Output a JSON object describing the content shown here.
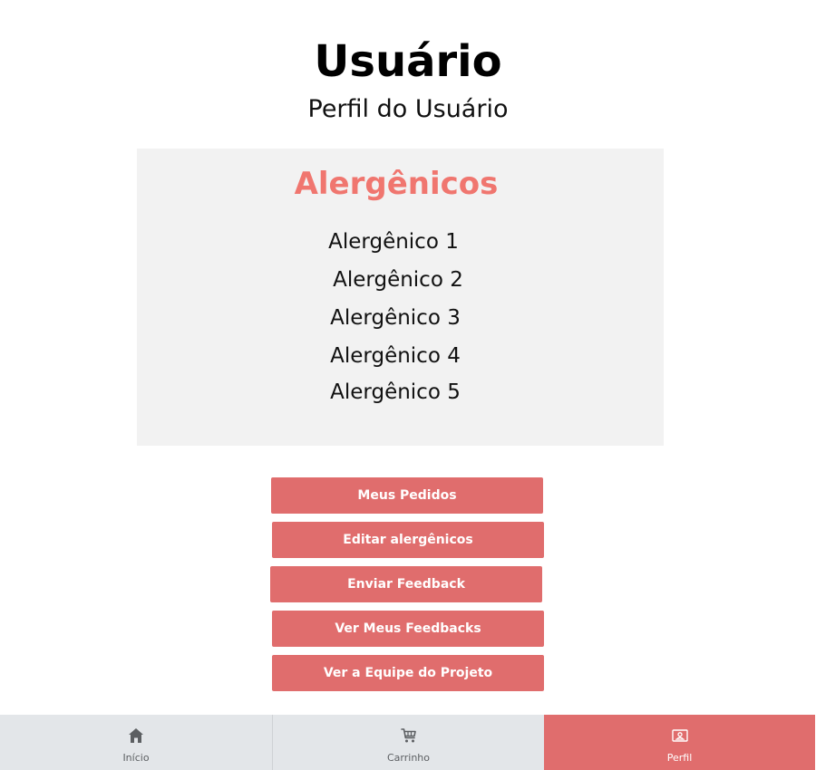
{
  "page": {
    "title": "Usuário",
    "subtitle": "Perfil do Usuário"
  },
  "allergens": {
    "title": "Alergênicos",
    "items": [
      "Alergênico 1",
      "Alergênico 2",
      "Alergênico 3",
      "Alergênico 4",
      "Alergênico 5"
    ]
  },
  "actions": {
    "my_orders": "Meus Pedidos",
    "edit_allergens": "Editar alergênicos",
    "send_feedback": "Enviar Feedback",
    "my_feedbacks": "Ver Meus Feedbacks",
    "project_team": "Ver a Equipe do Projeto"
  },
  "nav": {
    "items": [
      {
        "label": "Início",
        "icon": "home-icon",
        "active": false
      },
      {
        "label": "Carrinho",
        "icon": "cart-icon",
        "active": false
      },
      {
        "label": "Perfil",
        "icon": "profile-icon",
        "active": true
      }
    ]
  },
  "colors": {
    "accent": "#e06d6d",
    "allergen_title": "#f0766f",
    "card_background": "#f2f2f2",
    "nav_background": "#e3e6e9"
  }
}
